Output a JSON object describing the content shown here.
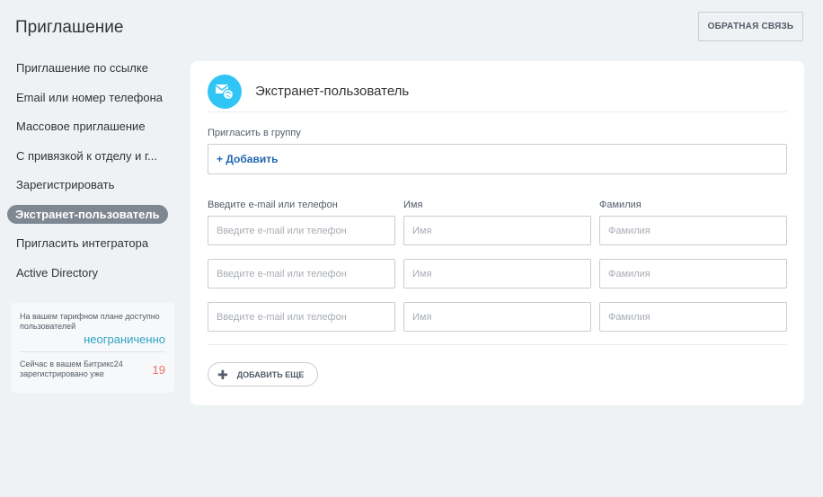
{
  "page": {
    "title": "Приглашение"
  },
  "toolbar": {
    "feedback_label": "ОБРАТНАЯ СВЯЗЬ"
  },
  "sidebar": {
    "items": [
      {
        "label": "Приглашение по ссылке"
      },
      {
        "label": "Email или номер телефона"
      },
      {
        "label": "Массовое приглашение"
      },
      {
        "label": "С привязкой к отделу и г..."
      },
      {
        "label": "Зарегистрировать"
      },
      {
        "label": "Экстранет-пользователь",
        "active": true
      },
      {
        "label": "Пригласить интегратора"
      },
      {
        "label": "Active Directory"
      }
    ]
  },
  "plan": {
    "limit_text": "На вашем тарифном плане доступно пользователей",
    "limit_value": "неограниченно",
    "registered_text": "Сейчас в вашем Битрикс24 зарегистрировано уже",
    "registered_count": "19"
  },
  "card": {
    "title": "Экстранет-пользователь",
    "group_label": "Пригласить в группу",
    "group_add": "Добавить",
    "columns": {
      "email": "Введите e-mail или телефон",
      "name": "Имя",
      "surname": "Фамилия"
    },
    "placeholders": {
      "email": "Введите e-mail или телефон",
      "name": "Имя",
      "surname": "Фамилия"
    },
    "add_more_label": "ДОБАВИТЬ ЕЩЕ"
  },
  "colors": {
    "accent": "#2fc6f6",
    "link": "#2067b0",
    "active_nav": "#7f8792",
    "limit_value": "#2fa5c4",
    "count": "#e8726e"
  }
}
